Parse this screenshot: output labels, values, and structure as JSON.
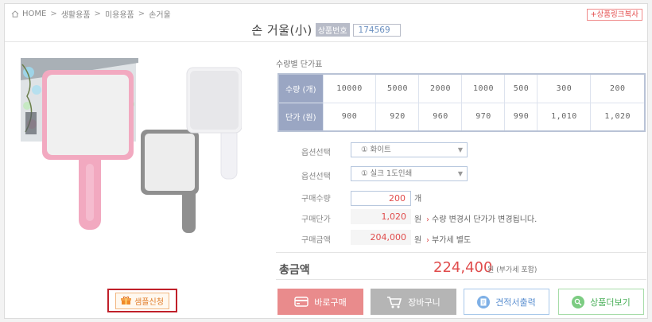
{
  "breadcrumb": {
    "home": "HOME",
    "items": [
      "생활용품",
      "미용용품",
      "손거울"
    ]
  },
  "link_copy_label": "+상품링크복사",
  "product": {
    "title": "손 거울(小)",
    "code_label": "상품번호",
    "code_value": "174569"
  },
  "price_table": {
    "caption": "수량별 단가표",
    "qty_header": "수량 (개)",
    "price_header": "단가 (원)",
    "quantities": [
      "10000",
      "5000",
      "2000",
      "1000",
      "500",
      "300",
      "200"
    ],
    "prices": [
      "900",
      "920",
      "960",
      "970",
      "990",
      "1,010",
      "1,020"
    ]
  },
  "form": {
    "option1_label": "옵션선택",
    "option1_value": "① 화이트",
    "option2_label": "옵션선택",
    "option2_value": "① 실크 1도인쇄",
    "qty_label": "구매수량",
    "qty_value": "200",
    "qty_unit": "개",
    "unit_price_label": "구매단가",
    "unit_price_value": "1,020",
    "unit_price_unit": "원",
    "unit_price_note": "수량 변경시 단가가 변경됩니다.",
    "amount_label": "구매금액",
    "amount_value": "204,000",
    "amount_unit": "원",
    "amount_note": "부가세 별도"
  },
  "total": {
    "label": "총금액",
    "value": "224,400",
    "unit": "원 (부가세 포함)"
  },
  "buttons": {
    "sample": "샘플신청",
    "buy": "바로구매",
    "cart": "장바구니",
    "quote": "견적서출력",
    "more": "상품더보기"
  },
  "colors": {
    "accent_red": "#e04c4c",
    "table_header": "#9aa6c3",
    "mirror_pink": "#f2a9c0",
    "mirror_gray": "#8f8f8f",
    "mirror_white": "#f2f2f4"
  }
}
